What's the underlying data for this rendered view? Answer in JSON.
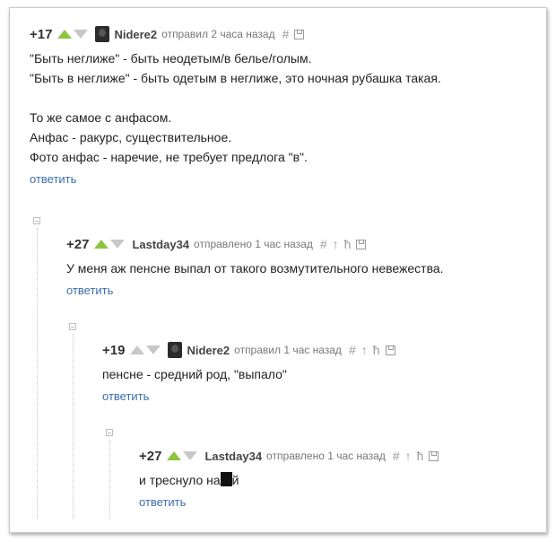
{
  "comments": [
    {
      "rating": "+17",
      "author": "Nidere2",
      "time": "отправил 2 часа назад",
      "lines": [
        "\"Быть неглиже\" - быть неодетым/в белье/голым.",
        "\"Быть в неглиже\" - быть одетым в неглиже, это ночная рубашка такая.",
        "",
        "То же самое с анфасом.",
        "Анфас - ракурс, существительное.",
        "Фото анфас - наречие, не требует предлога \"в\"."
      ],
      "reply": "ответить"
    },
    {
      "rating": "+27",
      "author": "Lastday34",
      "time": "отправлено 1 час назад",
      "lines": [
        "У меня аж пенсне выпал от такого возмутительного невежества."
      ],
      "reply": "ответить"
    },
    {
      "rating": "+19",
      "author": "Nidere2",
      "time": "отправил 1 час назад",
      "lines": [
        "пенсне - средний род, \"выпало\""
      ],
      "reply": "ответить"
    },
    {
      "rating": "+27",
      "author": "Lastday34",
      "time": "отправлено 1 час назад",
      "text_before": "и треснуло на",
      "text_after": "й",
      "reply": "ответить"
    }
  ],
  "icons": {
    "hash": "#",
    "parent": "↑",
    "branch": "ħ"
  },
  "colors": {
    "upvote": "#8cc63f",
    "link": "#3b6fb0"
  }
}
